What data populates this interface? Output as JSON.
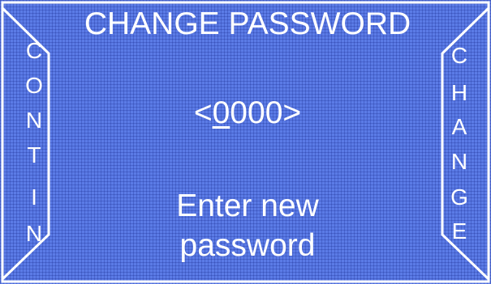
{
  "screen": {
    "title": "CHANGE PASSWORD",
    "background_color": "#5b7be6",
    "text_color": "#ffffff"
  },
  "left_button": {
    "letters": [
      "C",
      "O",
      "N",
      "T",
      "I",
      "N"
    ]
  },
  "right_button": {
    "letters": [
      "C",
      "H",
      "A",
      "N",
      "G",
      "E"
    ]
  },
  "password_entry": {
    "open_bracket": "<",
    "digits": [
      "0",
      "0",
      "0",
      "0"
    ],
    "active_index": 0,
    "close_bracket": ">"
  },
  "message": {
    "line1": "Enter new",
    "line2": "password"
  }
}
